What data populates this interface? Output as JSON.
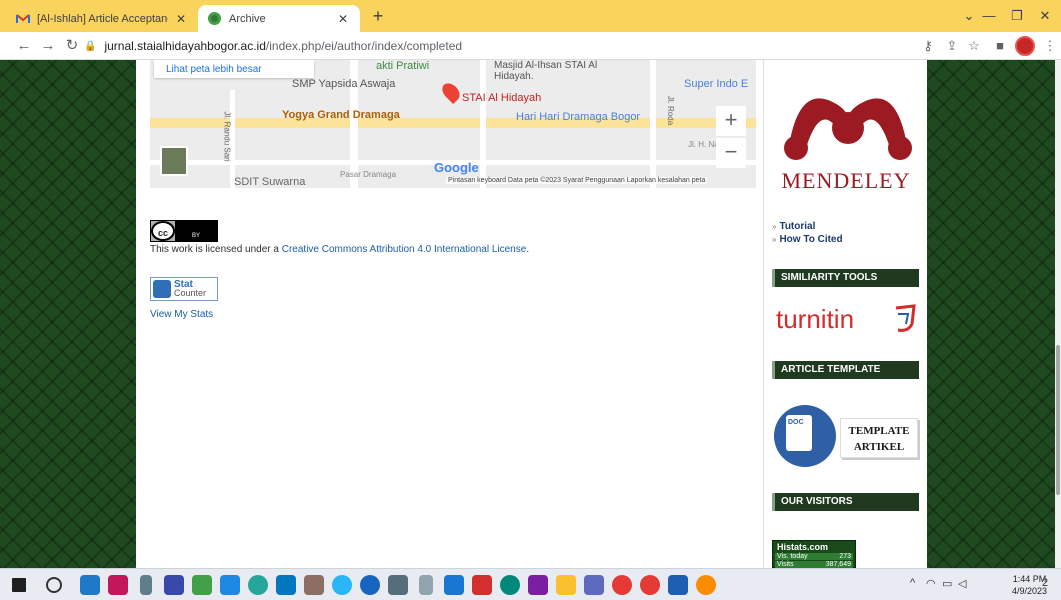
{
  "browser": {
    "tabs": [
      {
        "title": "[Al-Ishlah] Article Acceptance Let",
        "active": false
      },
      {
        "title": "Archive",
        "active": true
      }
    ],
    "new_tab": "+",
    "url_domain": "jurnal.staialhidayahbogor.ac.id",
    "url_path": "/index.php/ei/author/index/completed"
  },
  "map": {
    "larger_link": "Lihat peta lebih besar",
    "labels": {
      "place_pratiwi": "akti Pratiwi",
      "mosque": "Masjid Al-Ihsan STAI Al Hidayah.",
      "smp": "SMP Yapsida Aswaja",
      "stai": "STAI Al Hidayah",
      "superindo": "Super Indo E",
      "yogya": "Yogya Grand Dramaga",
      "harihari": "Hari Hari Dramaga Bogor",
      "jl_randu": "Jl. Randu Sari",
      "jl_roda": "Jl. Roda",
      "jl_h_na": "Jl. H. Na",
      "sdit": "SDIT Suwarna",
      "pasar": "Pasar Dramaga"
    },
    "google": "Google",
    "footer": "Pintasan keyboard   Data peta ©2023   Syarat Penggunaan   Laporkan kesalahan peta",
    "zoom_in": "+",
    "zoom_out": "−"
  },
  "license": {
    "badge_cc": "cc",
    "badge_by": "BY",
    "prefix": "This work is licensed under a ",
    "link": "Creative Commons Attribution 4.0 International License",
    "suffix": "."
  },
  "statcounter": {
    "line1": "Stat",
    "line2": "Counter",
    "view": "View My Stats"
  },
  "sidebar": {
    "mendeley": "MENDELEY",
    "links": [
      "Tutorial",
      "How To Cited"
    ],
    "headers": {
      "similarity": "SIMILIARITY TOOLS",
      "template": "ARTICLE TEMPLATE",
      "visitors": "OUR VISITORS"
    },
    "turnitin": "turnitin",
    "doc_label": "DOC",
    "template_badge": [
      "TEMPLATE",
      "ARTIKEL"
    ],
    "histats": {
      "brand": "Histats.com",
      "vis_today_label": "Vis. today",
      "vis_today": "273",
      "visits_label": "Visits",
      "visits": "387,649"
    }
  },
  "taskbar": {
    "time": "1:44 PM",
    "date": "4/9/2023",
    "notif_count": "2"
  },
  "colors": {
    "tabbar": "#fad35c",
    "page_bg": "#1f4a1f",
    "mendeley_red": "#9c1b23",
    "turnitin_red": "#d42b2b",
    "sidebar_header": "#1f3a1f"
  }
}
